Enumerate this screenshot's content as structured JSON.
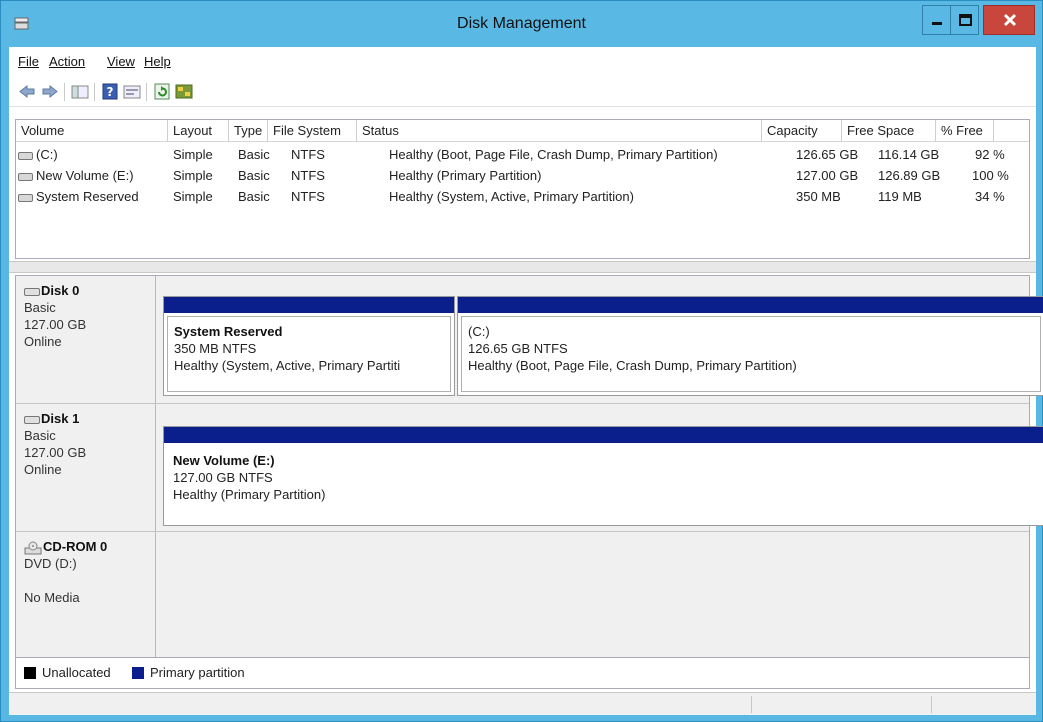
{
  "window": {
    "title": "Disk Management"
  },
  "menu": [
    {
      "label": "File",
      "key": "F"
    },
    {
      "label": "Action",
      "key": "A"
    },
    {
      "label": "View",
      "key": "V"
    },
    {
      "label": "Help",
      "key": "H"
    }
  ],
  "toolbar": [
    "back-icon",
    "forward-icon",
    "show-hide-console-tree-icon",
    "help-icon",
    "properties-icon",
    "refresh-icon",
    "disk-settings-icon"
  ],
  "columns": [
    "Volume",
    "Layout",
    "Type",
    "File System",
    "Status",
    "Capacity",
    "Free Space",
    "% Free"
  ],
  "volumes": [
    {
      "volume": "(C:)",
      "layout": "Simple",
      "type": "Basic",
      "fs": "NTFS",
      "status": "Healthy (Boot, Page File, Crash Dump, Primary Partition)",
      "capacity": "126.65 GB",
      "free": "116.14 GB",
      "pct": "92 %"
    },
    {
      "volume": "New Volume (E:)",
      "layout": "Simple",
      "type": "Basic",
      "fs": "NTFS",
      "status": "Healthy (Primary Partition)",
      "capacity": "127.00 GB",
      "free": "126.89 GB",
      "pct": "100 %"
    },
    {
      "volume": "System Reserved",
      "layout": "Simple",
      "type": "Basic",
      "fs": "NTFS",
      "status": "Healthy (System, Active, Primary Partition)",
      "capacity": "350 MB",
      "free": "119 MB",
      "pct": "34 %"
    }
  ],
  "disks": [
    {
      "name": "Disk 0",
      "kind": "Basic",
      "size": "127.00 GB",
      "state": "Online",
      "partitions": [
        {
          "title": "System Reserved",
          "size": "350 MB NTFS",
          "status": "Healthy (System, Active, Primary Partiti"
        },
        {
          "title": "(C:)",
          "size": "126.65 GB NTFS",
          "status": "Healthy (Boot, Page File, Crash Dump, Primary Partition)"
        }
      ]
    },
    {
      "name": "Disk 1",
      "kind": "Basic",
      "size": "127.00 GB",
      "state": "Online",
      "partitions": [
        {
          "title": "New Volume  (E:)",
          "size": "127.00 GB NTFS",
          "status": "Healthy (Primary Partition)"
        }
      ]
    },
    {
      "name": "CD-ROM 0",
      "kind": "DVD (D:)",
      "size": "",
      "state": "No Media",
      "partitions": []
    }
  ],
  "legend": [
    {
      "label": "Unallocated",
      "color": "#000000"
    },
    {
      "label": "Primary partition",
      "color": "#0a1e8c"
    }
  ],
  "colors": {
    "titlebar": "#5ab8e4",
    "close": "#c9463d",
    "partition_bar": "#0a1e8c"
  }
}
